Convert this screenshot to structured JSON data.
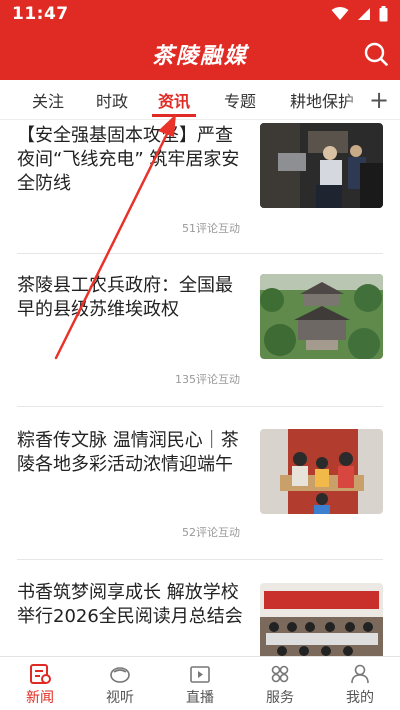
{
  "status_bar": {
    "time": "11:47"
  },
  "header": {
    "title": "茶陵融媒"
  },
  "tabs": [
    {
      "label": "关注",
      "active": false
    },
    {
      "label": "时政",
      "active": false
    },
    {
      "label": "资讯",
      "active": true
    },
    {
      "label": "专题",
      "active": false
    },
    {
      "label": "耕地保护",
      "active": false
    }
  ],
  "tab_add_label": "+",
  "news": [
    {
      "title": "【安全强基固本攻坚】严查夜间“飞线充电” 筑牢居家安全防线",
      "meta": "51评论互动"
    },
    {
      "title": "茶陵县工农兵政府：全国最早的县级苏维埃政权",
      "meta": "135评论互动"
    },
    {
      "title": "粽香传文脉 温情润民心｜茶陵各地多彩活动浓情迎端午",
      "meta": "52评论互动"
    },
    {
      "title": "书香筑梦阅享成长 解放学校举行2026全民阅读月总结会",
      "meta": ""
    }
  ],
  "bottom_nav": [
    {
      "label": "新闻",
      "icon": "news-icon",
      "active": true
    },
    {
      "label": "视听",
      "icon": "media-icon",
      "active": false
    },
    {
      "label": "直播",
      "icon": "live-icon",
      "active": false
    },
    {
      "label": "服务",
      "icon": "services-icon",
      "active": false
    },
    {
      "label": "我的",
      "icon": "profile-icon",
      "active": false
    }
  ],
  "colors": {
    "brand_red": "#e02a24",
    "annotation_red": "#e8322a"
  }
}
